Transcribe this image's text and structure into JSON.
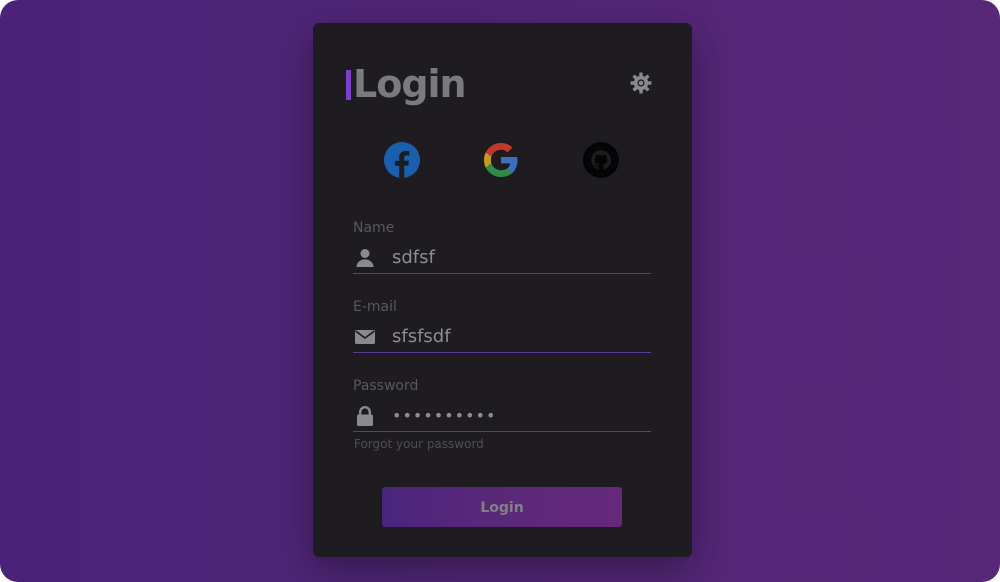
{
  "login_card": {
    "title": "Login",
    "settings_icon": "gear-icon",
    "social_providers": [
      {
        "name": "facebook",
        "icon": "facebook-icon"
      },
      {
        "name": "google",
        "icon": "google-icon"
      },
      {
        "name": "github",
        "icon": "github-icon"
      }
    ],
    "fields": {
      "name": {
        "label": "Name",
        "value": "sdfsf",
        "icon": "user-icon"
      },
      "email": {
        "label": "E-mail",
        "value": "sfsfsdf",
        "icon": "envelope-icon"
      },
      "password": {
        "label": "Password",
        "value": "••••••••••",
        "icon": "lock-icon"
      }
    },
    "forgot_password_link": "Forgot your password",
    "submit_label": "Login"
  },
  "colors": {
    "background_start": "#4a2378",
    "background_end": "#572778",
    "card": "#1e1c20",
    "accent": "#7d3fc9",
    "input_underline": "#5a3a9a"
  }
}
